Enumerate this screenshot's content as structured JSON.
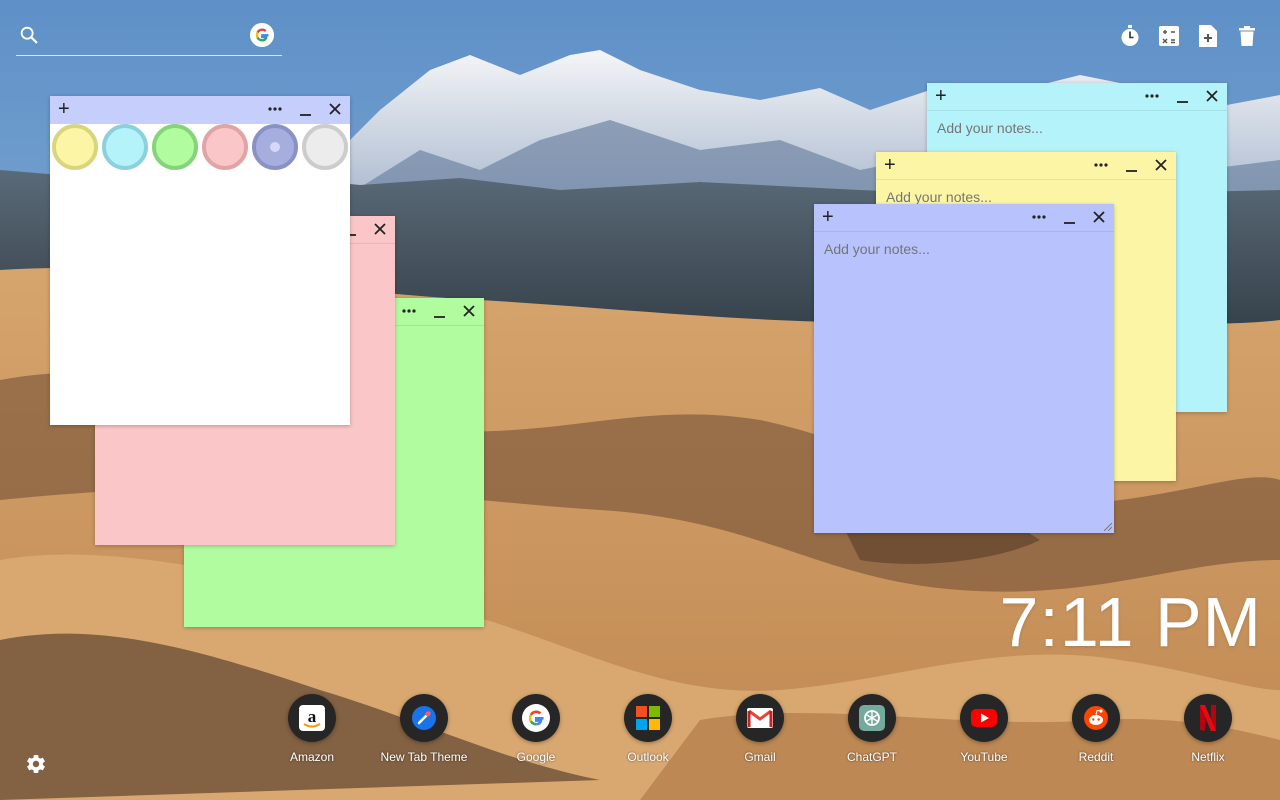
{
  "search": {
    "placeholder": "",
    "value": "",
    "icon": "search-icon",
    "engine_icon": "google-icon"
  },
  "toolbar": {
    "items": [
      {
        "name": "timer-icon"
      },
      {
        "name": "calculator-icon"
      },
      {
        "name": "add-note-icon"
      },
      {
        "name": "trash-icon"
      }
    ]
  },
  "notes": {
    "placeholder": "Add your notes...",
    "add_label": "+",
    "colors": {
      "cyan": "#b5f3fb",
      "yellow": "#fdf5a6",
      "blue": "#b8c3fd",
      "green": "#b0fc9f",
      "pink": "#fbc6c7",
      "white": "#ffffff"
    }
  },
  "palette": {
    "swatches": [
      {
        "name": "yellow",
        "fill": "#fdf5a6",
        "ring": "#d9d57c"
      },
      {
        "name": "cyan",
        "fill": "#b5f3fb",
        "ring": "#8bd0dc"
      },
      {
        "name": "green",
        "fill": "#b0fc9f",
        "ring": "#86d47a"
      },
      {
        "name": "pink",
        "fill": "#fbc6c7",
        "ring": "#e0a3a6"
      },
      {
        "name": "blue",
        "fill": "#a6aee0",
        "ring": "#8a92c4",
        "selected": true
      },
      {
        "name": "white",
        "fill": "#ececec",
        "ring": "#cccccc"
      }
    ]
  },
  "clock": {
    "time": "7:11 PM"
  },
  "dock": {
    "shortcuts": [
      {
        "label": "Amazon",
        "icon": "amazon-icon"
      },
      {
        "label": "New Tab Theme",
        "icon": "new-tab-theme-icon"
      },
      {
        "label": "Google",
        "icon": "google-icon"
      },
      {
        "label": "Outlook",
        "icon": "outlook-icon"
      },
      {
        "label": "Gmail",
        "icon": "gmail-icon"
      },
      {
        "label": "ChatGPT",
        "icon": "chatgpt-icon"
      },
      {
        "label": "YouTube",
        "icon": "youtube-icon"
      },
      {
        "label": "Reddit",
        "icon": "reddit-icon"
      },
      {
        "label": "Netflix",
        "icon": "netflix-icon"
      }
    ]
  },
  "settings": {
    "icon": "settings-gear-icon"
  }
}
